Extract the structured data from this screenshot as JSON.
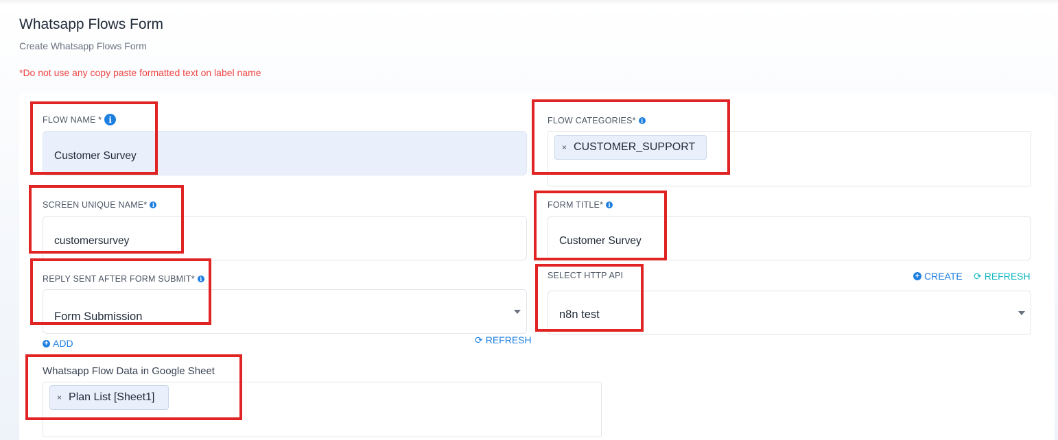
{
  "page": {
    "title": "Whatsapp Flows Form",
    "subtitle": "Create Whatsapp Flows Form",
    "warning": "*Do not use any copy paste formatted text on label name"
  },
  "form": {
    "flow_name": {
      "label": "FLOW NAME *",
      "value": "Customer Survey"
    },
    "flow_categories": {
      "label": "FLOW CATEGORIES*",
      "tags": [
        "CUSTOMER_SUPPORT"
      ]
    },
    "screen_unique_name": {
      "label": "SCREEN UNIQUE NAME*",
      "value": "customersurvey"
    },
    "form_title": {
      "label": "FORM TITLE*",
      "value": "Customer Survey"
    },
    "reply_after_submit": {
      "label": "REPLY SENT AFTER FORM SUBMIT*",
      "selected": "Form Submission",
      "add_label": "ADD",
      "refresh_label": "REFRESH"
    },
    "http_api": {
      "label": "SELECT HTTP API",
      "selected": "n8n test",
      "create_label": "CREATE",
      "refresh_label": "REFRESH"
    },
    "google_sheet": {
      "label": "Whatsapp Flow Data in Google Sheet",
      "tags": [
        "Plan List [Sheet1]"
      ]
    }
  },
  "icons": {
    "info": "info-icon",
    "tag_remove": "close-icon",
    "add": "plus-circle-icon",
    "refresh": "refresh-icon",
    "dropdown": "caret-down-icon"
  },
  "colors": {
    "accent": "#1d7fe0",
    "teal": "#14b8c4",
    "warning": "#ef4444",
    "highlight": "#e02424",
    "filled_field": "#e9f0fb"
  },
  "glyphs": {
    "tag_x": "×",
    "plus": "+",
    "refresh": "⟳",
    "info": "i"
  }
}
